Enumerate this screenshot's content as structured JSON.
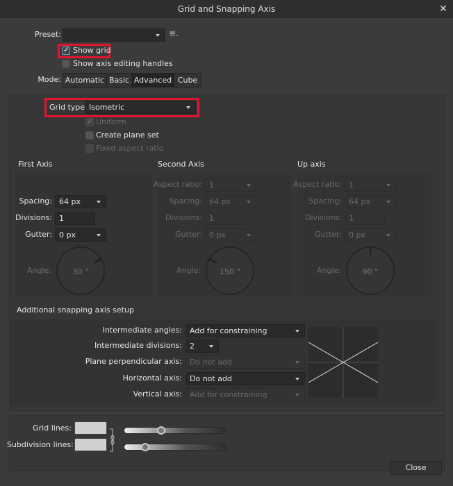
{
  "window": {
    "title": "Grid and Snapping Axis",
    "close_icon": "close-icon"
  },
  "preset": {
    "label": "Preset:",
    "value": "",
    "menu_icon": "list-menu-icon"
  },
  "show_grid": {
    "label": "Show grid",
    "checked": true
  },
  "show_axis_handles": {
    "label": "Show axis editing handles",
    "checked": false
  },
  "mode": {
    "label": "Mode:",
    "options": [
      "Automatic",
      "Basic",
      "Advanced",
      "Cube"
    ],
    "selected": "Advanced"
  },
  "grid_type": {
    "label": "Grid type:",
    "value": "Isometric"
  },
  "uniform": {
    "label": "Uniform",
    "checked": true,
    "disabled": true
  },
  "create_plane_set": {
    "label": "Create plane set",
    "checked": false
  },
  "fixed_aspect": {
    "label": "Fixed aspect ratio",
    "checked": false,
    "disabled": true
  },
  "axes": [
    {
      "title": "First Axis",
      "aspect_label": "",
      "aspect": "",
      "spacing_label": "Spacing:",
      "spacing": "64 px",
      "divisions_label": "Divisions:",
      "divisions": "1",
      "gutter_label": "Gutter:",
      "gutter": "0 px",
      "angle_label": "Angle:",
      "angle": "30 °",
      "angle_value": 30
    },
    {
      "title": "Second Axis",
      "aspect_label": "Aspect ratio:",
      "aspect": "1",
      "spacing_label": "Spacing:",
      "spacing": "64 px",
      "divisions_label": "Divisions:",
      "divisions": "1",
      "gutter_label": "Gutter:",
      "gutter": "0 px",
      "angle_label": "Angle:",
      "angle": "150 °",
      "angle_value": 150
    },
    {
      "title": "Up axis",
      "aspect_label": "Aspect ratio:",
      "aspect": "1",
      "spacing_label": "Spacing:",
      "spacing": "64 px",
      "divisions_label": "Divisions:",
      "divisions": "1",
      "gutter_label": "Gutter:",
      "gutter": "0 px",
      "angle_label": "Angle:",
      "angle": "90 °",
      "angle_value": 90
    }
  ],
  "snapping": {
    "title": "Additional snapping axis setup",
    "rows": [
      {
        "label": "Intermediate angles:",
        "value": "Add for constraining",
        "disabled": false
      },
      {
        "label": "Intermediate divisions:",
        "value": "2",
        "disabled": false
      },
      {
        "label": "Plane perpendicular axis:",
        "value": "Do not add",
        "disabled": true
      },
      {
        "label": "Horizontal axis:",
        "value": "Do not add",
        "disabled": false
      },
      {
        "label": "Vertical axis:",
        "value": "Add for constraining",
        "disabled": true
      }
    ]
  },
  "lines": {
    "grid_label": "Grid lines:",
    "sub_label": "Subdivision lines:",
    "grid_opacity": 0.36,
    "sub_opacity": 0.2,
    "grid_color": "#d0d0d0",
    "sub_color": "#d0d0d0",
    "link_icon": "chain-link-icon"
  },
  "footer": {
    "close_label": "Close"
  },
  "colors": {
    "highlight": "#e2152d",
    "background": "#3b3b3b"
  }
}
